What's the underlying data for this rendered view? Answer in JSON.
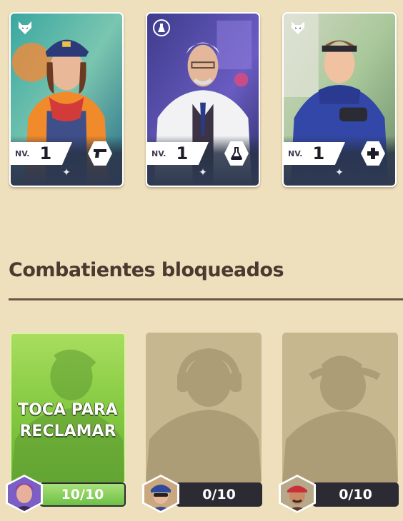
{
  "owned_cards": [
    {
      "level_prefix": "NV.",
      "level": "1",
      "faction_icon": "wolf-icon",
      "role_icon": "pistol-icon",
      "spark_icon": "sparkle-icon"
    },
    {
      "level_prefix": "NV.",
      "level": "1",
      "faction_icon": "flask-emblem-icon",
      "role_icon": "flask-icon",
      "spark_icon": "sparkle-icon"
    },
    {
      "level_prefix": "NV.",
      "level": "1",
      "faction_icon": "wolf-icon",
      "role_icon": "medic-plus-icon",
      "spark_icon": "sparkle-icon"
    }
  ],
  "section": {
    "title": "Combatientes bloqueados"
  },
  "locked": [
    {
      "action_label_line1": "TOCA PARA",
      "action_label_line2": "RECLAMAR",
      "progress_text": "10/10",
      "progress_fraction": 1.0,
      "state": "ready"
    },
    {
      "progress_text": "0/10",
      "progress_fraction": 0.0,
      "state": "locked"
    },
    {
      "progress_text": "0/10",
      "progress_fraction": 0.0,
      "state": "locked"
    }
  ],
  "colors": {
    "background": "#efe0bd",
    "ready_green": "#82c83f",
    "locked_tan": "#c7b78f",
    "bar_dark": "#2c2b33"
  }
}
